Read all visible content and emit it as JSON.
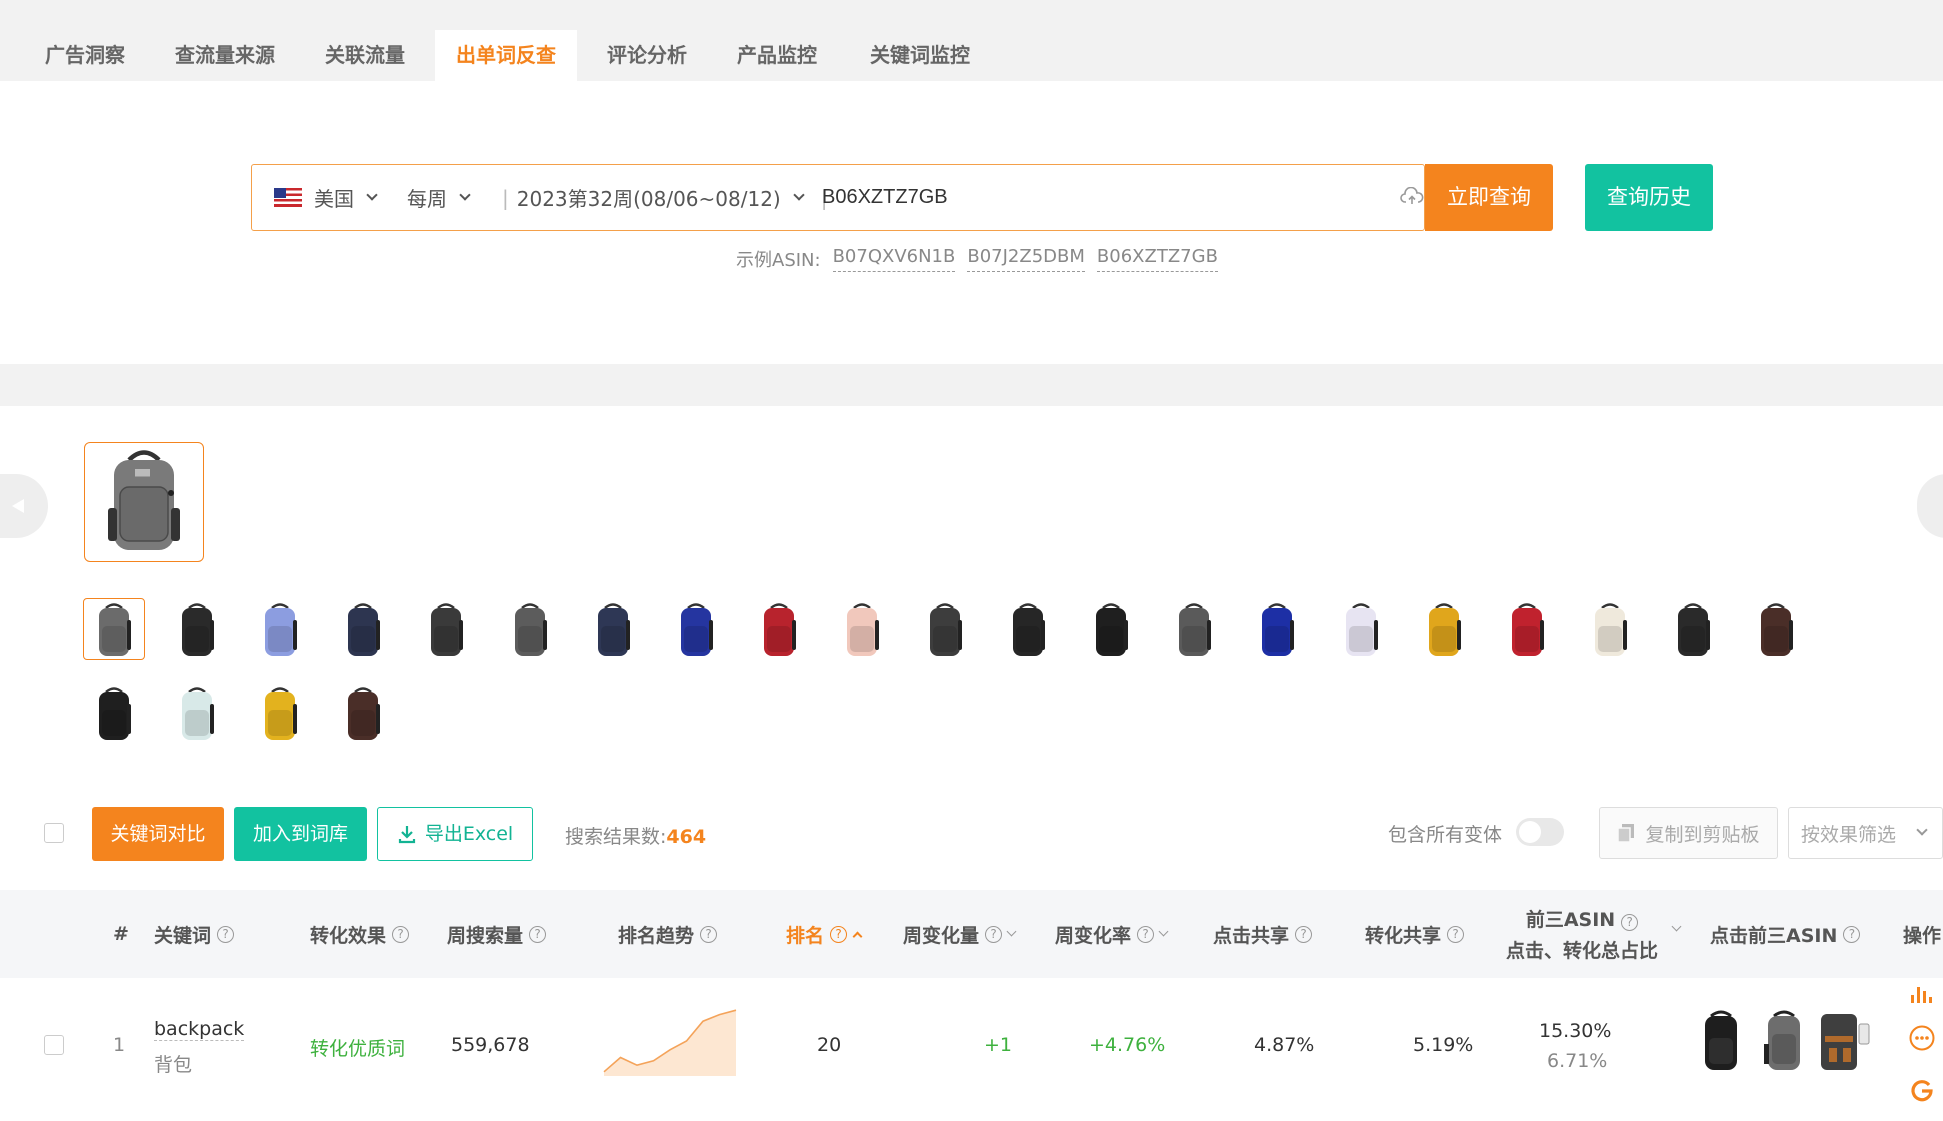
{
  "tabs": [
    "广告洞察",
    "查流量来源",
    "关联流量",
    "出单词反查",
    "评论分析",
    "产品监控",
    "关键词监控"
  ],
  "active_tab": "出单词反查",
  "search": {
    "country": "美国",
    "period": "每周",
    "week": "2023第32周(08/06~08/12)",
    "asin": "B06XZTZ7GB",
    "query_button": "立即查询",
    "history_button": "查询历史",
    "examples_label": "示例ASIN:",
    "examples": [
      "B07QXV6N1B",
      "B07J2Z5DBM",
      "B06XZTZ7GB"
    ]
  },
  "variants": {
    "row1": [
      "#6b6b6b",
      "#2a2a2a",
      "#8c9de0",
      "#2d3550",
      "#3a3a3a",
      "#5c5c5c",
      "#2e3755",
      "#2535a0",
      "#b8232d",
      "#f1c8bc",
      "#3d3d3d",
      "#262626",
      "#1f1f1f",
      "#5a5a5a",
      "#1d2fa5",
      "#e7e4f2",
      "#e0a61c",
      "#c0222e",
      "#efe9dc",
      "#2a2a2a",
      "#4a2e28"
    ],
    "row2": [
      "#1f1f1f",
      "#d8e9e8",
      "#e3b21e",
      "#4a2e28"
    ]
  },
  "toolbar": {
    "compare": "关键词对比",
    "add_to_lib": "加入到词库",
    "export": "导出Excel",
    "result_label": "搜索结果数:",
    "result_count": "464",
    "variant_label": "包含所有变体",
    "copy": "复制到剪贴板",
    "filter": "按效果筛选"
  },
  "table": {
    "headers": {
      "index": "#",
      "keyword": "关键词",
      "effect": "转化效果",
      "volume": "周搜索量",
      "trend": "排名趋势",
      "rank": "排名",
      "change": "周变化量",
      "change_rate": "周变化率",
      "click_share": "点击共享",
      "conv_share": "转化共享",
      "top3_line1": "前三ASIN",
      "top3_line2": "点击、转化总占比",
      "top3_click": "点击前三ASIN",
      "action": "操作"
    },
    "rows": [
      {
        "index": "1",
        "keyword": "backpack",
        "keyword_cn": "背包",
        "effect": "转化优质词",
        "volume": "559,678",
        "rank": "20",
        "change": "+1",
        "change_rate": "+4.76%",
        "click_share": "4.87%",
        "conv_share": "5.19%",
        "top3_click_total": "15.30%",
        "top3_conv_total": "6.71%",
        "trend": [
          58,
          45,
          52,
          48,
          38,
          30,
          12,
          6,
          2
        ]
      }
    ]
  },
  "colors": {
    "accent": "#f4841e",
    "green": "#12c2a0",
    "positive": "#3eb13e"
  }
}
